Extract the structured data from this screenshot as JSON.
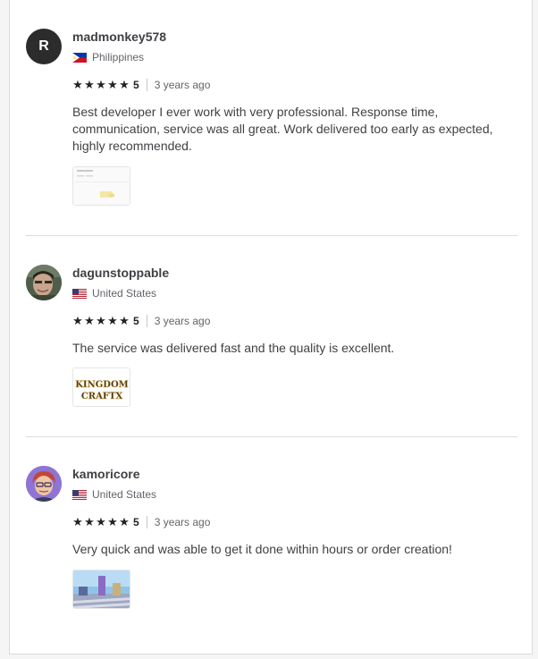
{
  "reviews": [
    {
      "username": "madmonkey578",
      "avatar_letter": "R",
      "country": "Philippines",
      "stars": [
        "★",
        "★",
        "★",
        "★",
        "★"
      ],
      "score": "5",
      "time": "3 years ago",
      "text": "Best developer I ever work with very professional. Response time, communication, service was all great. Work delivered too early as expected, highly recommended."
    },
    {
      "username": "dagunstoppable",
      "country": "United States",
      "stars": [
        "★",
        "★",
        "★",
        "★",
        "★"
      ],
      "score": "5",
      "time": "3 years ago",
      "text": "The service was delivered fast and the quality is excellent.",
      "thumb_logo_line1": "KINGDOM",
      "thumb_logo_line2": "CRAFTX"
    },
    {
      "username": "kamoricore",
      "country": "United States",
      "stars": [
        "★",
        "★",
        "★",
        "★",
        "★"
      ],
      "score": "5",
      "time": "3 years ago",
      "text": "Very quick and was able to get it done within hours or order creation!"
    }
  ],
  "colors": {
    "star": "#222325",
    "text": "#404145",
    "muted": "#62646a",
    "divider": "#dadbdd"
  }
}
